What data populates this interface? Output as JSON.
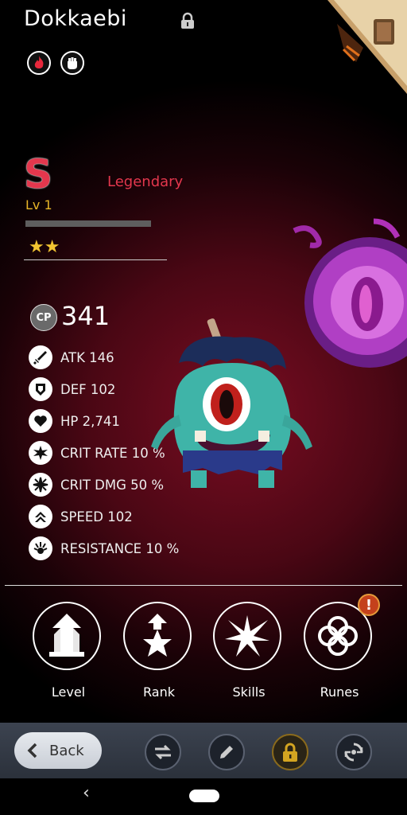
{
  "monster": {
    "name": "Dokkaebi",
    "grade": "S",
    "rarity": "Legendary",
    "level": "Lv 1",
    "xp_fraction": 0.0,
    "stars": "★★",
    "star_count": 2,
    "cp_badge": "CP",
    "cp": "341",
    "elements": [
      "fire-icon",
      "fist-icon"
    ]
  },
  "stats": [
    {
      "icon": "sword-icon",
      "label": "ATK 146"
    },
    {
      "icon": "shield-icon",
      "label": "DEF 102"
    },
    {
      "icon": "heart-icon",
      "label": "HP 2,741"
    },
    {
      "icon": "crit-rate-icon",
      "label": "CRIT RATE 10 %"
    },
    {
      "icon": "crit-dmg-icon",
      "label": "CRIT DMG 50 %"
    },
    {
      "icon": "speed-icon",
      "label": "SPEED 102"
    },
    {
      "icon": "resistance-icon",
      "label": "RESISTANCE 10 %"
    }
  ],
  "actions": [
    {
      "label": "Level",
      "icon": "level-up-icon"
    },
    {
      "label": "Rank",
      "icon": "rank-up-icon"
    },
    {
      "label": "Skills",
      "icon": "skills-icon"
    },
    {
      "label": "Runes",
      "icon": "runes-icon",
      "alert": "!"
    }
  ],
  "toolbar": {
    "back_label": "Back",
    "icons": [
      "swap-icon",
      "rename-icon",
      "lock-icon",
      "release-icon"
    ]
  },
  "colors": {
    "accent_red": "#e3374d",
    "level_gold": "#e8b628",
    "star_gold": "#f2c531",
    "alert_orange": "#c4411c"
  }
}
